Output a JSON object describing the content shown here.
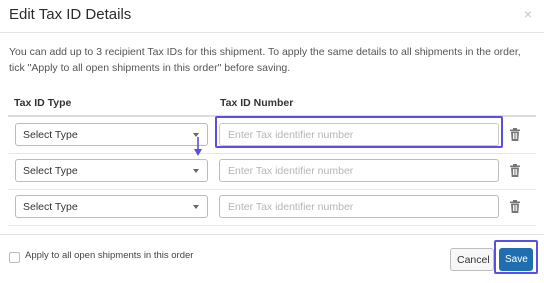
{
  "dialog": {
    "title": "Edit Tax ID Details",
    "close_glyph": "×",
    "description": "You can add up to 3 recipient Tax IDs for this shipment. To apply the same details to all shipments in the order, tick \"Apply to all open shipments in this order\" before saving."
  },
  "table": {
    "columns": [
      "Tax ID Type",
      "Tax ID Number"
    ],
    "rows": [
      {
        "type_value": "Select Type",
        "number_value": "",
        "number_placeholder": "Enter Tax identifier number"
      },
      {
        "type_value": "Select Type",
        "number_value": "",
        "number_placeholder": "Enter Tax identifier number"
      },
      {
        "type_value": "Select Type",
        "number_value": "",
        "number_placeholder": "Enter Tax identifier number"
      }
    ]
  },
  "footer": {
    "apply_all_label": "Apply to all open shipments in this order",
    "apply_all_checked": false,
    "cancel_label": "Cancel",
    "save_label": "Save"
  },
  "colors": {
    "accent": "#5b4fe0",
    "primary_button": "#1f6fb0"
  },
  "icons": [
    "close-icon",
    "chevron-down-icon",
    "trash-icon",
    "arrow-down-icon"
  ]
}
